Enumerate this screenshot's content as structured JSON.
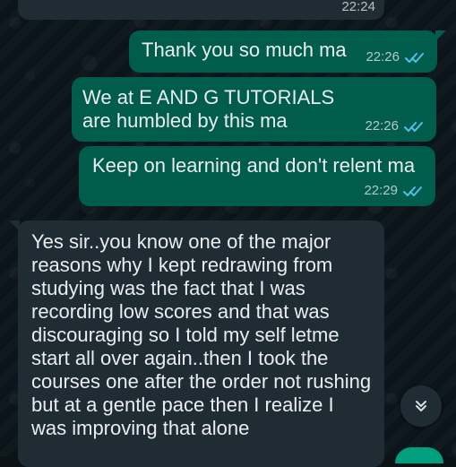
{
  "messages": [
    {
      "id": "m0",
      "direction": "incoming",
      "text": "",
      "time": "22:24"
    },
    {
      "id": "m1",
      "direction": "outgoing",
      "text": "Thank you so much ma",
      "time": "22:26"
    },
    {
      "id": "m2",
      "direction": "outgoing",
      "text": "We at E AND G TUTORIALS are humbled by this ma",
      "time": "22:26"
    },
    {
      "id": "m3",
      "direction": "outgoing",
      "text": "Keep on learning and don't relent ma",
      "time": "22:29"
    },
    {
      "id": "m4",
      "direction": "incoming",
      "text": "Yes sir..you know one of the major reasons why I kept redrawing from studying was the fact that I was recording low scores and that was discouraging so I told my self letme start all over again..then I took the courses one after the order not rushing but at a gentle pace then I realize I was improving that alone"
    }
  ],
  "icons": {
    "double_check": "double-check-icon",
    "scroll_down": "double-chevron-down-icon"
  },
  "colors": {
    "background": "#0b141a",
    "incoming_bubble": "#1f2c34",
    "outgoing_bubble": "#005c4b",
    "text": "#e9edef",
    "read_tick": "#53bdeb",
    "fab": "#00a884"
  }
}
